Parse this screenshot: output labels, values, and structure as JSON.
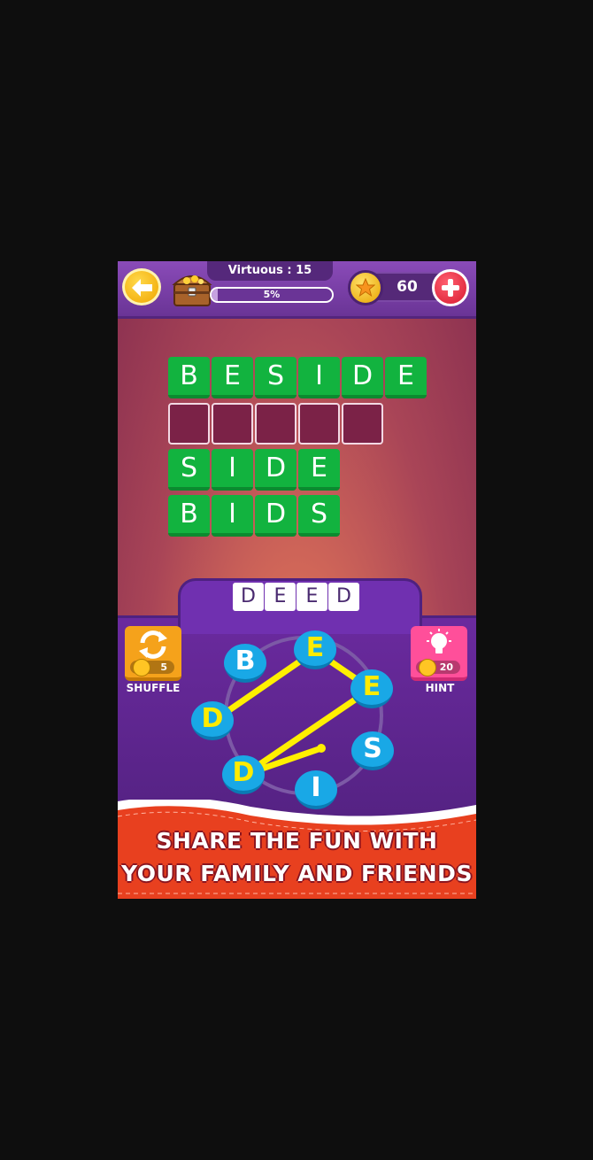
{
  "header": {
    "level_name": "Virtuous : 15",
    "progress_text": "5%",
    "progress_value": 0.05,
    "coins": "60"
  },
  "board": {
    "rows": [
      {
        "letters": [
          "B",
          "E",
          "S",
          "I",
          "D",
          "E"
        ],
        "solved": true
      },
      {
        "letters": [
          "",
          "",
          "",
          "",
          ""
        ],
        "solved": false
      },
      {
        "letters": [
          "S",
          "I",
          "D",
          "E"
        ],
        "solved": true
      },
      {
        "letters": [
          "B",
          "I",
          "D",
          "S"
        ],
        "solved": true
      }
    ]
  },
  "current_word": [
    "D",
    "E",
    "E",
    "D"
  ],
  "controls": {
    "shuffle_label": "SHUFFLE",
    "shuffle_cost": "5",
    "hint_label": "HINT",
    "hint_cost": "20"
  },
  "wheel_letters": [
    "B",
    "E",
    "E",
    "S",
    "I",
    "D",
    "D"
  ],
  "promo": {
    "line1": "SHARE THE FUN WITH",
    "line2": "YOUR FAMILY AND FRIENDS"
  },
  "colors": {
    "tile_green": "#12b33f",
    "wheel_blue": "#19a8e6",
    "selected_letter": "#ffeb00",
    "banner_red": "#e8401f"
  }
}
